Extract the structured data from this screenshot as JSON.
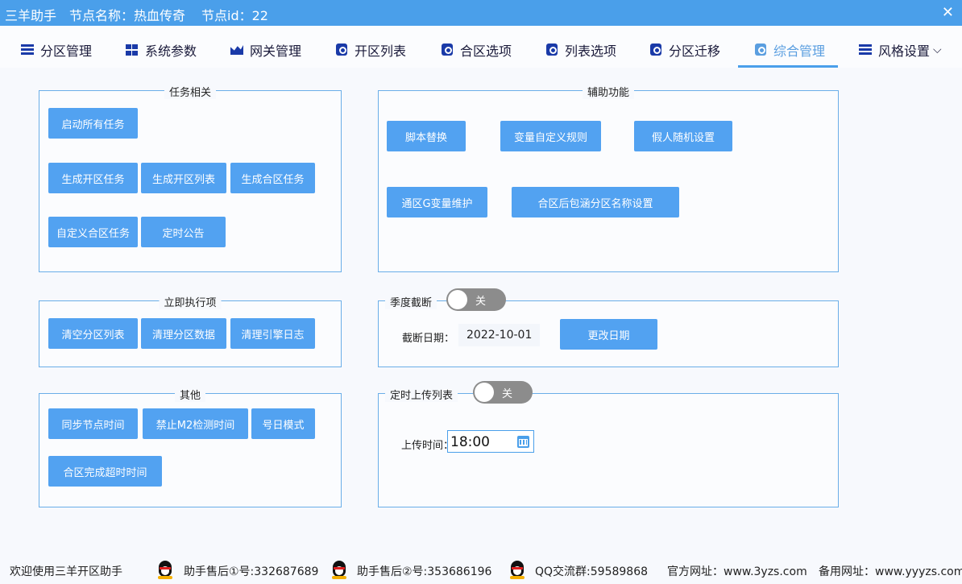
{
  "titlebar": {
    "app_name": "三羊助手",
    "node_name": "节点名称：热血传奇",
    "node_id": "节点id：22",
    "close_glyph": "✕"
  },
  "tabs": [
    {
      "label": "分区管理",
      "icon": "list-icon"
    },
    {
      "label": "系统参数",
      "icon": "windows-icon"
    },
    {
      "label": "网关管理",
      "icon": "area-chart-icon"
    },
    {
      "label": "开区列表",
      "icon": "question-icon"
    },
    {
      "label": "合区选项",
      "icon": "question-icon"
    },
    {
      "label": "列表选项",
      "icon": "question-icon"
    },
    {
      "label": "分区迁移",
      "icon": "question-icon"
    },
    {
      "label": "综合管理",
      "icon": "question-icon",
      "active": true
    },
    {
      "label": "风格设置",
      "icon": "list-icon",
      "dropdown": "⌵"
    }
  ],
  "task_group": {
    "title": "任务相关",
    "buttons": [
      "启动所有任务",
      "生成开区任务",
      "生成开区列表",
      "生成合区任务",
      "自定义合区任务",
      "定时公告"
    ]
  },
  "aux_group": {
    "title": "辅助功能",
    "buttons": [
      "脚本替换",
      "变量自定义规则",
      "假人随机设置",
      "通区G变量维护",
      "合区后包涵分区名称设置"
    ]
  },
  "immediate_group": {
    "title": "立即执行项",
    "buttons": [
      "清空分区列表",
      "清理分区数据",
      "清理引擎日志"
    ]
  },
  "quarter_group": {
    "title": "季度截断",
    "toggle": "关",
    "date_label": "截断日期：",
    "date_value": "2022-10-01",
    "change_button": "更改日期"
  },
  "other_group": {
    "title": "其他",
    "buttons": [
      "同步节点时间",
      "禁止M2检测时间",
      "号日模式",
      "合区完成超时时间"
    ]
  },
  "upload_group": {
    "title": "定时上传列表",
    "toggle": "关",
    "time_label": "上传时间：",
    "time_value": "18:00"
  },
  "footer": {
    "welcome": "欢迎使用三羊开区助手",
    "support1": "助手售后①号:332687689",
    "support2": "助手售后②号:353686196",
    "qq_group": "QQ交流群:59589868",
    "website": "官方网址：www.3yzs.com",
    "backup_site": "备用网址：www.yyyzs.com"
  },
  "colors": {
    "titlebar": "#4a9fea",
    "button": "#52a2f1",
    "border": "#6aaee8",
    "toggle_off": "#8c8c8c"
  }
}
